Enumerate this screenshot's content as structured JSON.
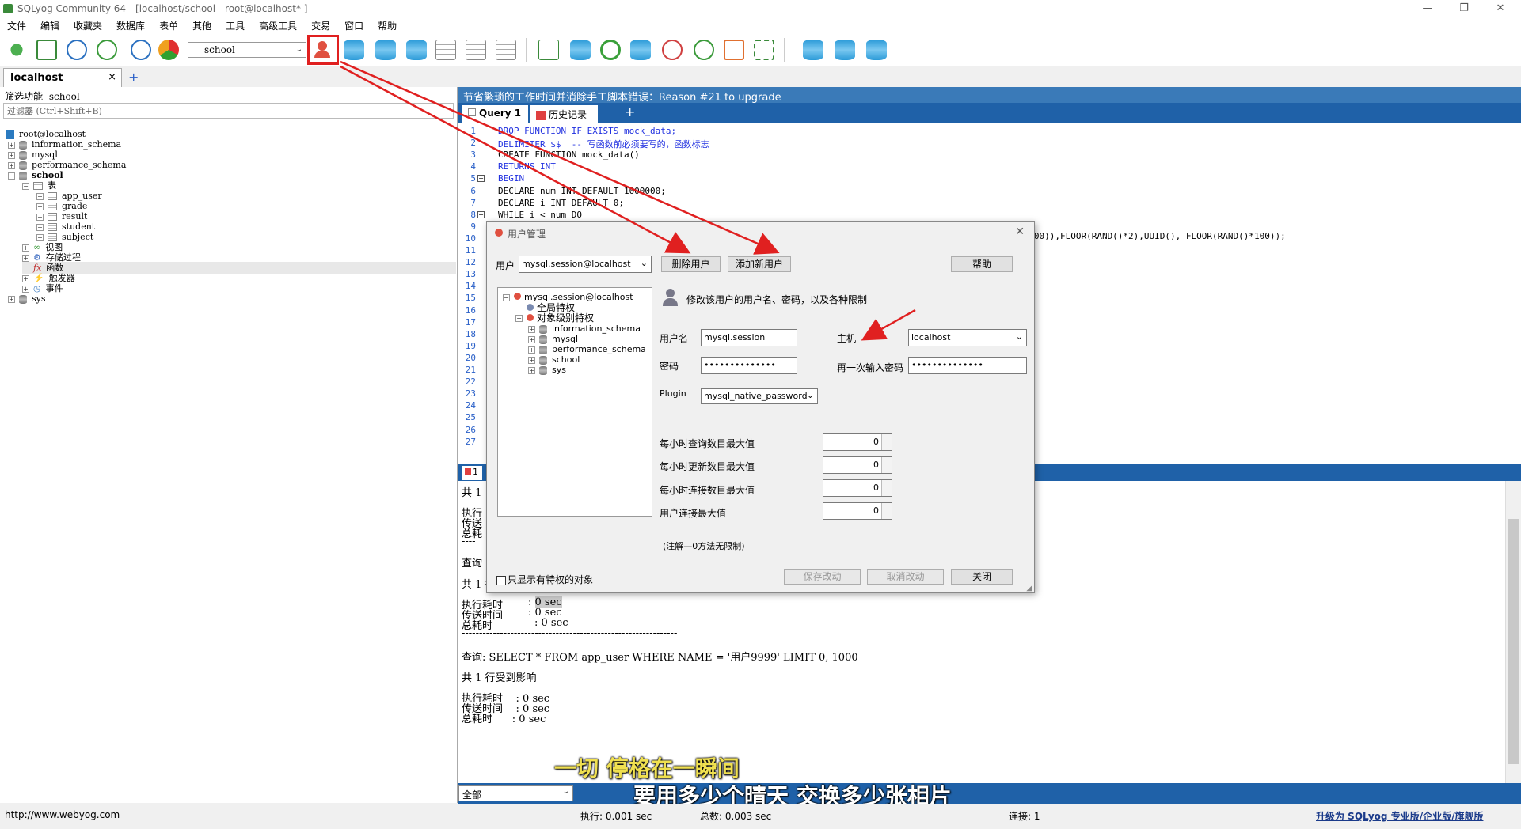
{
  "window": {
    "title": "SQLyog Community 64 - [localhost/school - root@localhost* ]"
  },
  "menu": [
    "文件",
    "编辑",
    "收藏夹",
    "数据库",
    "表单",
    "其他",
    "工具",
    "高级工具",
    "交易",
    "窗口",
    "帮助"
  ],
  "toolbar": {
    "database_selected": "school",
    "icons": [
      "connect-icon",
      "new-query-icon",
      "execute-icon",
      "execute-all-icon",
      "execute-edit-icon",
      "schema-icon",
      "user-manager-icon",
      "create-db-icon",
      "backup-icon",
      "restore-icon",
      "table-data-icon",
      "grid-icon",
      "import-icon",
      "sync-icon",
      "refresh-icon",
      "copy-db-icon",
      "scheduler-icon",
      "notify-icon",
      "query-builder-icon",
      "schema-designer-icon",
      "data-sync-icon",
      "db-sync-icon",
      "export-icon"
    ]
  },
  "connection_tab": {
    "label": "localhost",
    "close": "×",
    "add": "+"
  },
  "object_browser": {
    "filter_label": "筛选功能",
    "filter_db": "school",
    "filter_placeholder": "过滤器 (Ctrl+Shift+B)",
    "root": "root@localhost",
    "databases": [
      "information_schema",
      "mysql",
      "performance_schema",
      "school"
    ],
    "school_children": {
      "tables_label": "表",
      "tables": [
        "app_user",
        "grade",
        "result",
        "student",
        "subject"
      ],
      "views": "视图",
      "procedures": "存储过程",
      "functions": "函数",
      "triggers": "触发器",
      "events": "事件"
    },
    "sys": "sys"
  },
  "notice": "节省繁琐的工作时间并消除手工脚本错误：Reason #21 to upgrade",
  "editor_tabs": {
    "query": "Query 1",
    "history": "历史记录",
    "add": "+"
  },
  "editor": {
    "line_numbers": [
      "1",
      "2",
      "3",
      "4",
      "5",
      "6",
      "7",
      "8",
      "9",
      "10",
      "11",
      "12",
      "13",
      "14",
      "15",
      "16",
      "17",
      "18",
      "19",
      "20",
      "21",
      "22",
      "23",
      "24",
      "25",
      "26",
      "27"
    ],
    "lines": [
      "DROP FUNCTION IF EXISTS mock_data;",
      "DELIMITER $$  -- 写函数前必须要写的，函数标志",
      "CREATE FUNCTION mock_data()",
      "RETURNS INT",
      "BEGIN",
      "DECLARE num INT DEFAULT 1000000;",
      "DECLARE i INT DEFAULT 0;",
      "WHILE i < num DO"
    ],
    "line10_tail": "00)+100000000)),FLOOR(RAND()*2),UUID(), FLOOR(RAND()*100));"
  },
  "result_tab": "1",
  "messages": {
    "m1": "共 1",
    "m2": "执行",
    "m3": "传送",
    "m4": "总耗",
    "m5": "----",
    "m6": "查询",
    "affected": "共 1 行受到影响",
    "exec_label": "执行耗时",
    "exec_value": ": 0 sec",
    "transfer_label": "传送时间",
    "transfer_value": ": 0 sec",
    "total_label": "总耗时",
    "total_value": ": 0 sec",
    "divider": "--------------------------------------------------------------",
    "query2": "查询: SELECT * FROM app_user WHERE NAME = '用户9999' LIMIT 0, 1000",
    "affected2": "共 1 行受到影响",
    "exec2": "执行耗时    : 0 sec",
    "transfer2": "传送时间    : 0 sec",
    "total2": "总耗时      : 0 sec"
  },
  "subtitles": {
    "line1": "一切 停格在一瞬间",
    "line2": "要用多少个晴天 交换多少张相片"
  },
  "result_filter": "全部",
  "status": {
    "url": "http://www.webyog.com",
    "exec": "执行: 0.001 sec",
    "total": "总数: 0.003 sec",
    "conn": "连接: 1",
    "upgrade": "升级为 SQLyog 专业版/企业版/旗舰版"
  },
  "dialog": {
    "title": "用户管理",
    "user_label": "用户",
    "user_value": "mysql.session@localhost",
    "delete_btn": "删除用户",
    "add_btn": "添加新用户",
    "help_btn": "帮助",
    "tree": {
      "root": "mysql.session@localhost",
      "global": "全局特权",
      "object_level": "对象级别特权",
      "dbs": [
        "information_schema",
        "mysql",
        "performance_schema",
        "school",
        "sys"
      ]
    },
    "header": "修改该用户的用户名、密码，以及各种限制",
    "username_label": "用户名",
    "username_value": "mysql.session",
    "host_label": "主机",
    "host_value": "localhost",
    "password_label": "密码",
    "password_value": "••••••••••••••",
    "confirm_label": "再一次输入密码",
    "confirm_value": "••••••••••••••",
    "plugin_label": "Plugin",
    "plugin_value": "mysql_native_password",
    "limits": [
      {
        "label": "每小时查询数目最大值",
        "value": "0"
      },
      {
        "label": "每小时更新数目最大值",
        "value": "0"
      },
      {
        "label": "每小时连接数目最大值",
        "value": "0"
      },
      {
        "label": "用户连接最大值",
        "value": "0"
      }
    ],
    "note": "(注解—0方法无限制)",
    "show_only_label": "只显示有特权的对象",
    "save_btn": "保存改动",
    "cancel_btn": "取消改动",
    "close_btn": "关闭"
  },
  "colors": {
    "accent": "#1f61a8",
    "highlight": "#e02020",
    "keyword": "#2030e0",
    "comment": "#2a8a2a"
  }
}
